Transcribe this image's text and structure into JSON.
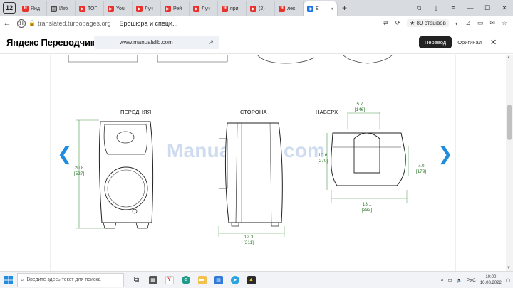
{
  "tabs": {
    "counter": "12",
    "items": [
      {
        "label": "Янд",
        "color": "#e8322b",
        "glyph": "Я"
      },
      {
        "label": "Изб",
        "color": "#4a4a4a",
        "glyph": "▤"
      },
      {
        "label": "ТОГ",
        "color": "#e8322b",
        "glyph": "▶"
      },
      {
        "label": "You",
        "color": "#e8322b",
        "glyph": "▶"
      },
      {
        "label": "Луч",
        "color": "#e8322b",
        "glyph": "▶"
      },
      {
        "label": "Рей",
        "color": "#e8322b",
        "glyph": "▶"
      },
      {
        "label": "Луч",
        "color": "#e8322b",
        "glyph": "▶"
      },
      {
        "label": "при",
        "color": "#e8322b",
        "glyph": "Я"
      },
      {
        "label": "(2)",
        "color": "#e8322b",
        "glyph": "▶"
      },
      {
        "label": "лек",
        "color": "#e8322b",
        "glyph": "Я"
      },
      {
        "label": "Е",
        "color": "#1a73e8",
        "glyph": "◉",
        "active": true
      }
    ],
    "new_tab_label": "+"
  },
  "address": {
    "url": "translated.turbopages.org",
    "title": "Брошюра и специ...",
    "rating": "★ 89 отзывов"
  },
  "translator": {
    "logo": "Яндекс Переводчик",
    "source_url": "www.manualslib.com",
    "btn_translation": "Перевод",
    "btn_original": "Оригинал",
    "close": "✕"
  },
  "document": {
    "watermark": "ManualsLib.com",
    "views": {
      "front": "ПЕРЕДНЯЯ",
      "side": "СТОРОНА",
      "top": "НАВЕРХ"
    },
    "dimensions": {
      "front_height": "20.8\n[527]",
      "side_width": "12.3\n[311]",
      "top_height_left": "10.6\n[270]",
      "top_height_right": "7.0\n[179]",
      "top_width_top": "5.7\n[146]",
      "top_width_bottom": "13.1\n[333]"
    }
  },
  "taskbar": {
    "search_placeholder": "Введите здесь текст для поиска",
    "lang": "РУС",
    "time": "10:00",
    "date": "10.08.2022"
  }
}
